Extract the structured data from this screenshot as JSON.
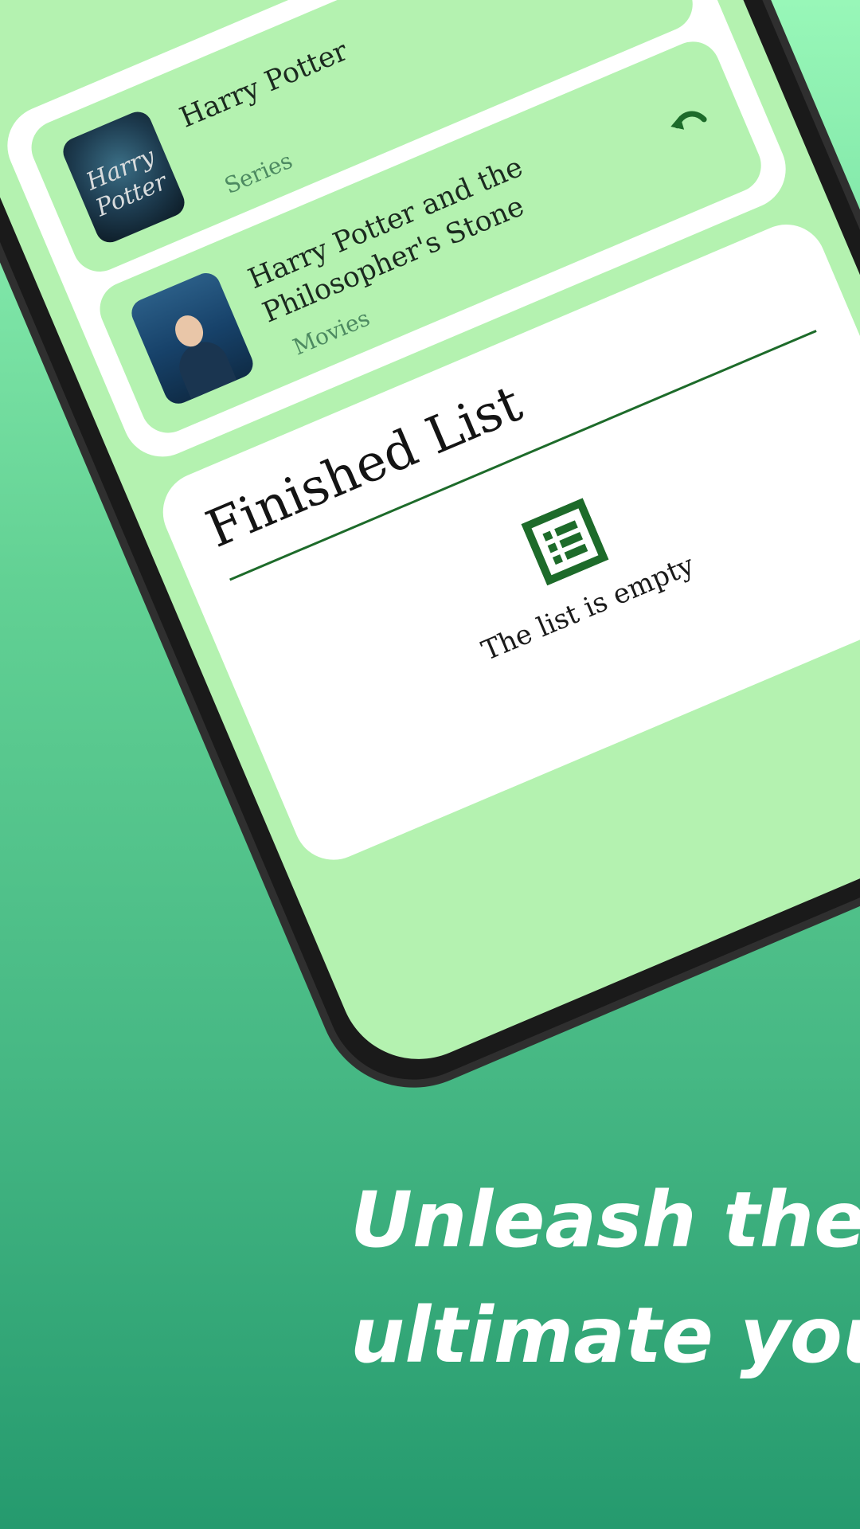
{
  "watching": {
    "items": [
      {
        "title": "Harry Potter",
        "subtitle": "Series",
        "poster_text": "Harry Potter"
      },
      {
        "title": "Harry Potter and the Philosopher's Stone",
        "subtitle": "Movies"
      }
    ]
  },
  "finished": {
    "title": "Finished List",
    "empty_text": "The list is empty"
  },
  "tagline": {
    "line1": "Unleash the",
    "line2": "ultimate you"
  },
  "colors": {
    "accent": "#1d6b2a",
    "screen_bg": "#b4f2b0",
    "card_bg": "#ffffff"
  }
}
